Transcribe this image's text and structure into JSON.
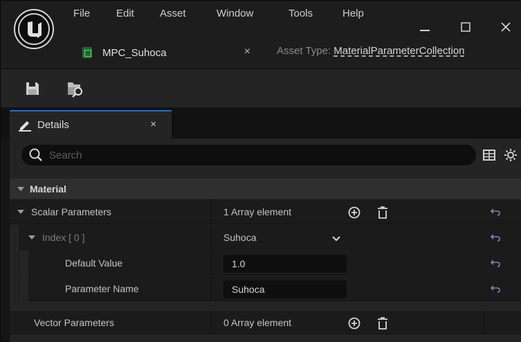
{
  "menu": [
    "File",
    "Edit",
    "Asset",
    "Window",
    "Tools",
    "Help"
  ],
  "window_controls": {
    "minimize": "—",
    "maximize": "☐",
    "close": "✕"
  },
  "asset_tab": {
    "name": "MPC_Suhoca",
    "close": "×"
  },
  "asset_type": {
    "prefix": "Asset Type: ",
    "value": "MaterialParameterCollection"
  },
  "toolbar": {
    "icons": [
      "save-icon",
      "browse-icon"
    ]
  },
  "details_tab": {
    "label": "Details",
    "close": "×"
  },
  "search": {
    "placeholder": "Search"
  },
  "category": {
    "label": "Material"
  },
  "rows": {
    "scalar": {
      "label": "Scalar Parameters",
      "value": "1 Array element"
    },
    "index": {
      "label": "Index [ 0 ]",
      "value": "Suhoca"
    },
    "default_value": {
      "label": "Default Value",
      "value": "1.0"
    },
    "parameter_name": {
      "label": "Parameter Name",
      "value": "Suhoca"
    },
    "vector": {
      "label": "Vector Parameters",
      "value": "0 Array element"
    }
  },
  "colors": {
    "accent": "#2a6fbf",
    "background": "#151515",
    "panel": "#242424"
  }
}
